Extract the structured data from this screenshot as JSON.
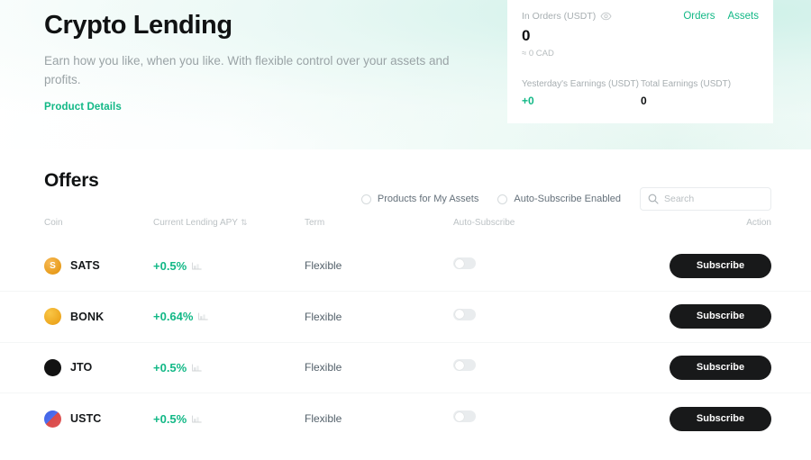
{
  "hero": {
    "title": "Crypto Lending",
    "subtitle": "Earn how you like, when you like. With flexible control over your assets and profits.",
    "link_label": "Product Details",
    "accent_color": "#12b886"
  },
  "stats_card": {
    "in_orders_label": "In Orders (USDT)",
    "in_orders_value": "0",
    "conversion": "≈ 0 CAD",
    "eye_icon": "eye-icon",
    "links": [
      {
        "label": "Orders"
      },
      {
        "label": "Assets"
      }
    ],
    "yesterday_label": "Yesterday's Earnings (USDT)",
    "yesterday_value": "+0",
    "total_label": "Total Earnings (USDT)",
    "total_value": "0"
  },
  "offers": {
    "title": "Offers",
    "filters": [
      {
        "label": "Products for My Assets",
        "checked": false
      },
      {
        "label": "Auto-Subscribe Enabled",
        "checked": false
      }
    ],
    "search": {
      "placeholder": "Search",
      "value": "",
      "icon": "search-icon"
    },
    "columns": {
      "coin": "Coin",
      "apy": "Current Lending APY",
      "apy_sort_icon": "⇅",
      "term": "Term",
      "auto_subscribe": "Auto-Subscribe",
      "action": "Action"
    },
    "rows": [
      {
        "coin": "SATS",
        "icon": "sats-coin-icon",
        "icon_glyph": "S",
        "apy": "+0.5%",
        "term": "Flexible",
        "auto_subscribe": false,
        "action_label": "Subscribe"
      },
      {
        "coin": "BONK",
        "icon": "bonk-coin-icon",
        "icon_glyph": "",
        "apy": "+0.64%",
        "term": "Flexible",
        "auto_subscribe": false,
        "action_label": "Subscribe"
      },
      {
        "coin": "JTO",
        "icon": "jto-coin-icon",
        "icon_glyph": "",
        "apy": "+0.5%",
        "term": "Flexible",
        "auto_subscribe": false,
        "action_label": "Subscribe"
      },
      {
        "coin": "USTC",
        "icon": "ustc-coin-icon",
        "icon_glyph": "",
        "apy": "+0.5%",
        "term": "Flexible",
        "auto_subscribe": false,
        "action_label": "Subscribe"
      }
    ]
  }
}
